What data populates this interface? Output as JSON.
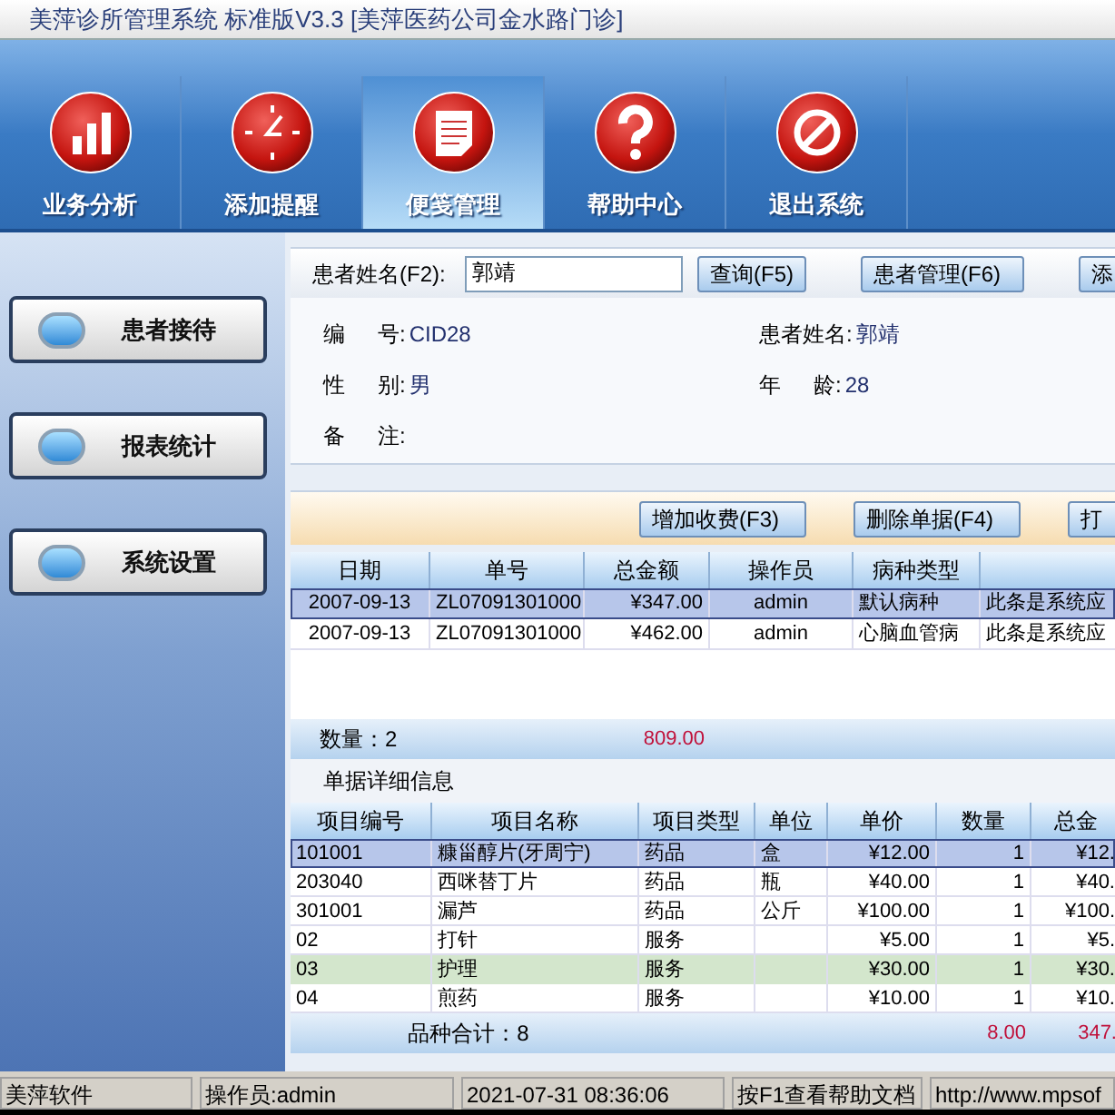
{
  "window": {
    "title": "美萍诊所管理系统 标准版V3.3 [美萍医药公司金水路门诊]"
  },
  "nav": [
    {
      "label": "业务分析",
      "kind": "chart",
      "selected": false
    },
    {
      "label": "添加提醒",
      "kind": "clock",
      "selected": false
    },
    {
      "label": "便笺管理",
      "kind": "note",
      "selected": true
    },
    {
      "label": "帮助中心",
      "kind": "help",
      "selected": false
    },
    {
      "label": "退出系统",
      "kind": "stop",
      "selected": false
    }
  ],
  "sidebar": {
    "items": [
      {
        "label": "患者接待"
      },
      {
        "label": "报表统计"
      },
      {
        "label": "系统设置"
      }
    ]
  },
  "search": {
    "label": "患者姓名(F2):",
    "value": "郭靖",
    "buttons": [
      "查询(F5)",
      "患者管理(F6)",
      "添"
    ]
  },
  "patient": {
    "fields": [
      {
        "label": [
          "编",
          "号:"
        ],
        "value": "CID28"
      },
      {
        "label": [
          "患者姓名:"
        ],
        "value": "郭靖"
      },
      {
        "label": [
          "性",
          "别:"
        ],
        "value": "男"
      },
      {
        "label": [
          "年",
          "龄:"
        ],
        "value": "28"
      },
      {
        "label": [
          "备",
          "注:"
        ]
      }
    ]
  },
  "bill_toolbar": {
    "buttons": [
      "增加收费(F3)",
      "删除单据(F4)",
      "打"
    ]
  },
  "bills": {
    "columns": [
      "日期",
      "单号",
      "总金额",
      "操作员",
      "病种类型"
    ],
    "rows": [
      {
        "cells": [
          "2007-09-13",
          "ZL07091301000",
          "¥347.00",
          "admin",
          "默认病种",
          "此条是系统应"
        ],
        "selected": true
      },
      {
        "cells": [
          "2007-09-13",
          "ZL07091301000",
          "¥462.00",
          "admin",
          "心脑血管病",
          "此条是系统应"
        ],
        "selected": false
      }
    ],
    "footer": {
      "count": "数量：2",
      "total": "809.00"
    }
  },
  "details": {
    "title": "单据详细信息",
    "columns": [
      "项目编号",
      "项目名称",
      "项目类型",
      "单位",
      "单价",
      "数量",
      "总金"
    ],
    "rows": [
      {
        "cells": [
          "101001",
          "糠甾醇片(牙周宁)",
          "药品",
          "盒",
          "¥12.00",
          "1",
          "¥12."
        ],
        "selected": true,
        "highlighted": false
      },
      {
        "cells": [
          "203040",
          "西咪替丁片",
          "药品",
          "瓶",
          "¥40.00",
          "1",
          "¥40."
        ],
        "selected": false,
        "highlighted": false
      },
      {
        "cells": [
          "301001",
          "漏芦",
          "药品",
          "公斤",
          "¥100.00",
          "1",
          "¥100."
        ],
        "selected": false,
        "highlighted": false
      },
      {
        "cells": [
          "02",
          "打针",
          "服务",
          "",
          "¥5.00",
          "1",
          "¥5."
        ],
        "selected": false,
        "highlighted": false
      },
      {
        "cells": [
          "03",
          "护理",
          "服务",
          "",
          "¥30.00",
          "1",
          "¥30."
        ],
        "selected": false,
        "highlighted": true
      },
      {
        "cells": [
          "04",
          "煎药",
          "服务",
          "",
          "¥10.00",
          "1",
          "¥10."
        ],
        "selected": false,
        "highlighted": false
      }
    ],
    "footer": {
      "count": "品种合计：8",
      "quantity": "8.00",
      "total": "347."
    }
  },
  "status_bar": [
    "美萍软件",
    "操作员:admin",
    "2021-07-31 08:36:06",
    "按F1查看帮助文档",
    "http://www.mpsof"
  ]
}
